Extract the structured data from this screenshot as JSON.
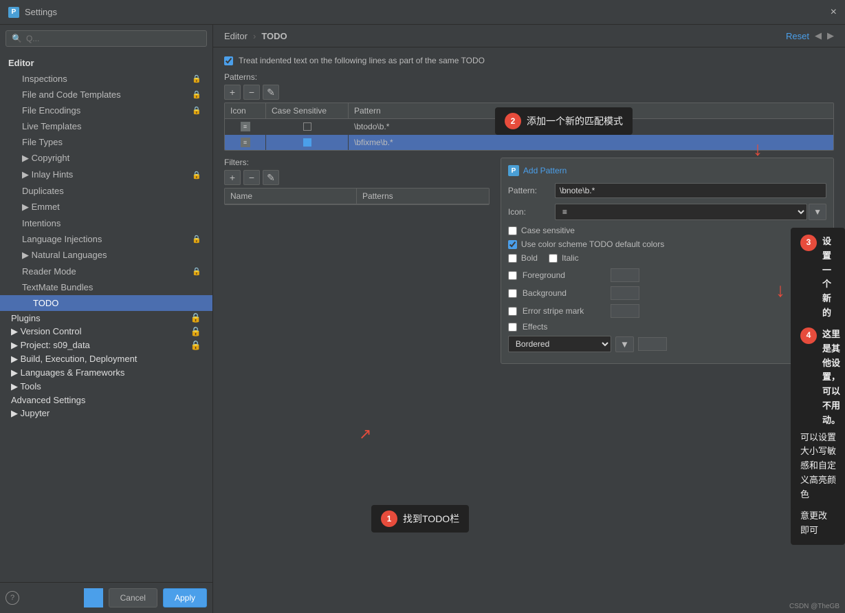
{
  "window": {
    "title": "Settings",
    "close_btn": "×"
  },
  "search": {
    "placeholder": "Q..."
  },
  "sidebar": {
    "editor_label": "Editor",
    "items": [
      {
        "id": "inspections",
        "label": "Inspections",
        "indent": 1,
        "has_lock": true
      },
      {
        "id": "file-code-templates",
        "label": "File and Code Templates",
        "indent": 1,
        "has_lock": true
      },
      {
        "id": "file-encodings",
        "label": "File Encodings",
        "indent": 1,
        "has_lock": true
      },
      {
        "id": "live-templates",
        "label": "Live Templates",
        "indent": 1,
        "has_lock": false
      },
      {
        "id": "file-types",
        "label": "File Types",
        "indent": 1,
        "has_lock": false
      },
      {
        "id": "copyright",
        "label": "Copyright",
        "indent": 1,
        "has_lock": false,
        "expandable": true
      },
      {
        "id": "inlay-hints",
        "label": "Inlay Hints",
        "indent": 1,
        "has_lock": true,
        "expandable": true
      },
      {
        "id": "duplicates",
        "label": "Duplicates",
        "indent": 1,
        "has_lock": false
      },
      {
        "id": "emmet",
        "label": "Emmet",
        "indent": 1,
        "has_lock": false,
        "expandable": true
      },
      {
        "id": "intentions",
        "label": "Intentions",
        "indent": 1,
        "has_lock": false
      },
      {
        "id": "language-injections",
        "label": "Language Injections",
        "indent": 1,
        "has_lock": true
      },
      {
        "id": "natural-languages",
        "label": "Natural Languages",
        "indent": 1,
        "has_lock": false,
        "expandable": true
      },
      {
        "id": "reader-mode",
        "label": "Reader Mode",
        "indent": 1,
        "has_lock": true
      },
      {
        "id": "textmate-bundles",
        "label": "TextMate Bundles",
        "indent": 1,
        "has_lock": false
      },
      {
        "id": "todo",
        "label": "TODO",
        "indent": 2,
        "selected": true
      }
    ],
    "sections": [
      {
        "id": "plugins",
        "label": "Plugins",
        "has_lock": true
      },
      {
        "id": "version-control",
        "label": "Version Control",
        "expandable": true,
        "has_lock": true
      },
      {
        "id": "project",
        "label": "Project: s09_data",
        "expandable": true,
        "has_lock": true
      },
      {
        "id": "build-exec",
        "label": "Build, Execution, Deployment",
        "expandable": true,
        "has_lock": false
      },
      {
        "id": "languages-frameworks",
        "label": "Languages & Frameworks",
        "expandable": true,
        "has_lock": false
      },
      {
        "id": "tools",
        "label": "Tools",
        "expandable": true,
        "has_lock": false
      },
      {
        "id": "advanced",
        "label": "Advanced Settings",
        "has_lock": false
      },
      {
        "id": "jupyter",
        "label": "Jupyter",
        "expandable": true,
        "has_lock": false
      }
    ]
  },
  "breadcrumb": {
    "parent": "Editor",
    "separator": "›",
    "current": "TODO",
    "reset": "Reset"
  },
  "main": {
    "checkbox_label": "Treat indented text on the following lines as part of the same TODO",
    "patterns_label": "Patterns:",
    "add_btn": "+",
    "remove_btn": "−",
    "edit_btn": "✎",
    "columns": {
      "icon": "Icon",
      "case_sensitive": "Case Sensitive",
      "pattern": "Pattern"
    },
    "rows": [
      {
        "icon": "≡",
        "case_checked": false,
        "pattern": "\\btodo\\b.*",
        "selected": false
      },
      {
        "icon": "≡",
        "case_checked": true,
        "pattern": "\\bfixme\\b.*",
        "selected": true
      }
    ],
    "filters_label": "Filters:",
    "filters_columns": {
      "name": "Name",
      "patterns": "Patterns"
    },
    "add_pattern_title": "Add Pattern",
    "form": {
      "pattern_label": "Pattern:",
      "pattern_value": "\\bnote\\b.*",
      "icon_label": "Icon:",
      "icon_value": "≡",
      "case_sensitive_label": "Case sensitive",
      "use_color_label": "Use color scheme TODO default colors"
    },
    "color_section": {
      "bold_label": "Bold",
      "italic_label": "Italic",
      "foreground_label": "Foreground",
      "background_label": "Background",
      "error_stripe_label": "Error stripe mark",
      "effects_label": "Effects",
      "effects_value": "Bordered"
    }
  },
  "tooltips": {
    "t1": "添加一个新的匹配模式",
    "t2_title": "设置一个新的匹配规则",
    "t2_body": "note是我们的关键字，如果你需要其他的\n关键字，随意更改即可",
    "t3_title": "这里是其他设置，可以不用动。",
    "t3_body": "可以设置大小写敏感和自定义高亮颜色",
    "t4": "找到TODO栏"
  },
  "steps": {
    "s1": "1",
    "s2": "2",
    "s3": "3",
    "s4": "4"
  },
  "footer": {
    "cancel": "Cancel",
    "apply": "Apply"
  },
  "watermark": "CSDN @TheGB"
}
